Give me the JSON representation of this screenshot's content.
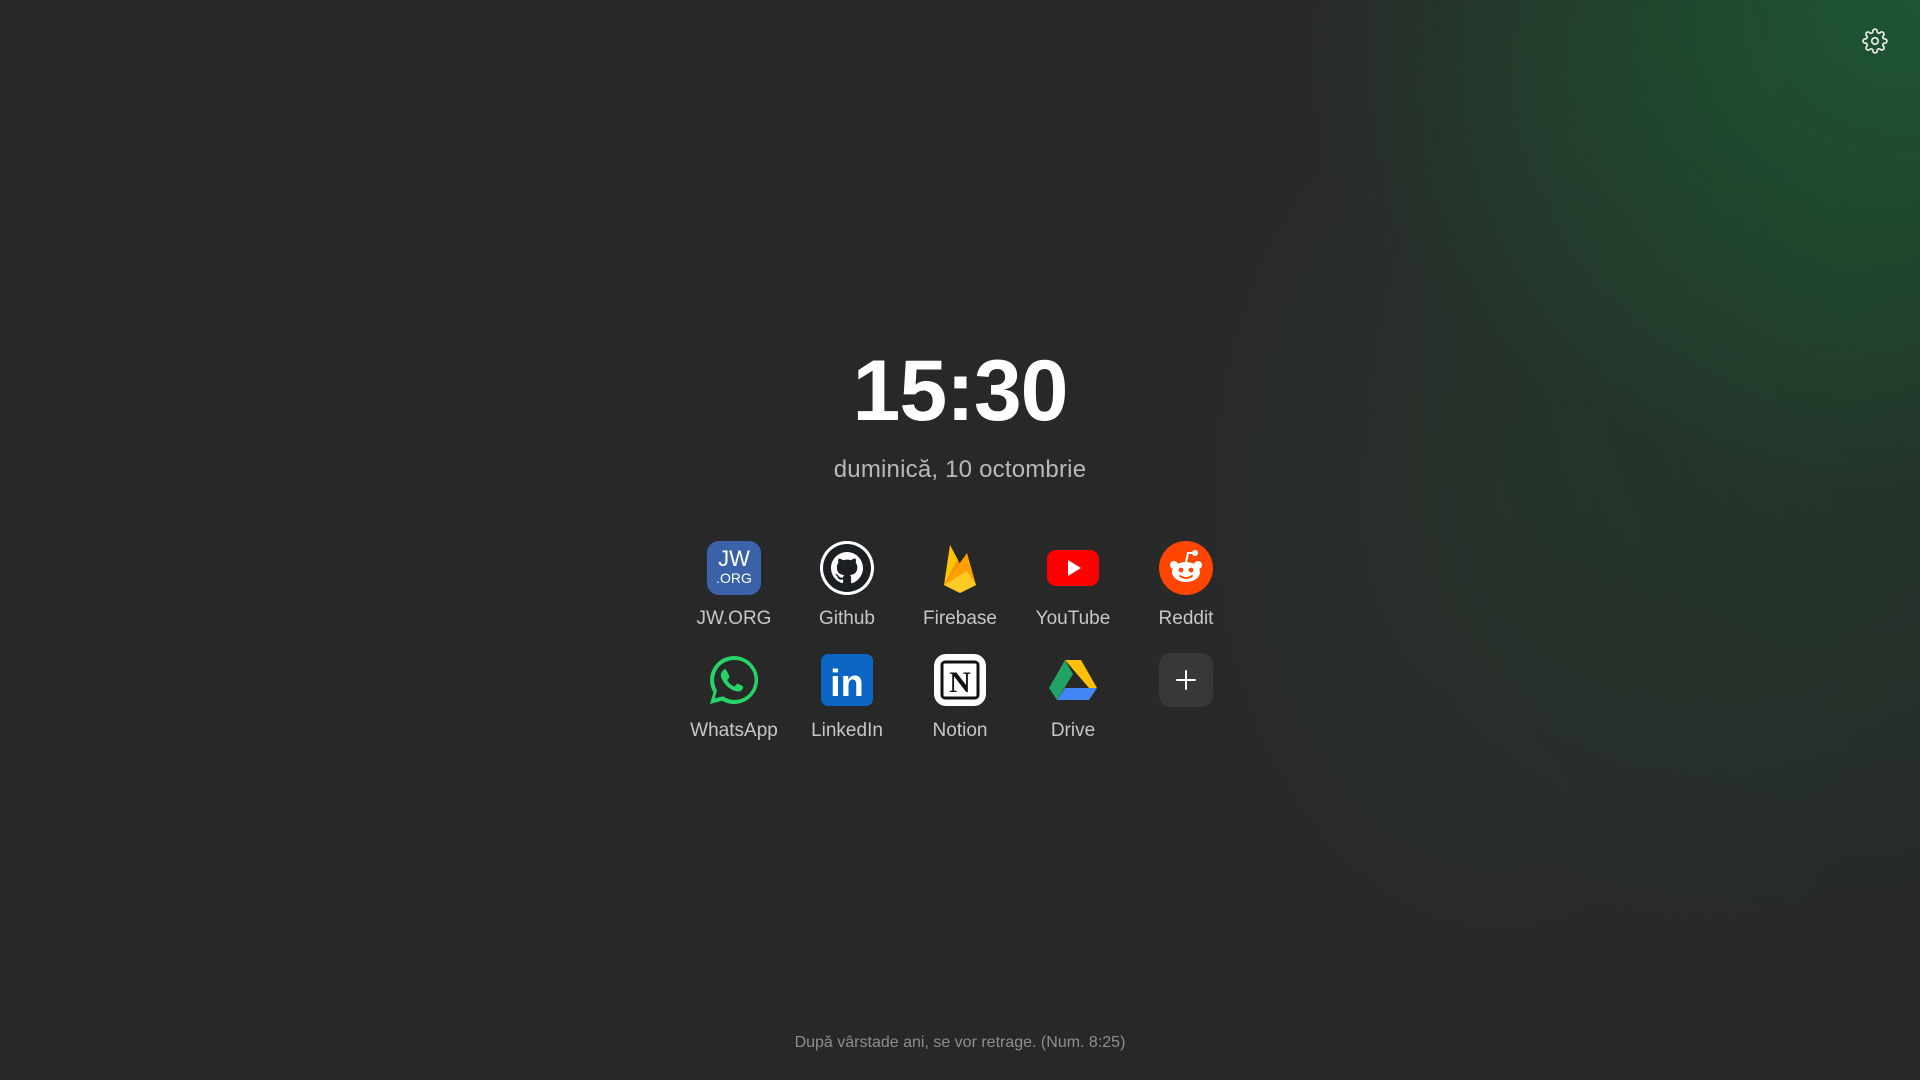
{
  "clock": {
    "time": "15:30",
    "date": "duminică, 10 octombrie"
  },
  "settings": {
    "icon": "gear-icon"
  },
  "shortcuts": [
    {
      "label": "JW.ORG",
      "icon": "jworg-icon",
      "icon_text_top": "JW",
      "icon_text_bottom": ".ORG",
      "color": "#3a62a8"
    },
    {
      "label": "Github",
      "icon": "github-icon",
      "color": "#ffffff"
    },
    {
      "label": "Firebase",
      "icon": "firebase-icon",
      "color": "#ffa611"
    },
    {
      "label": "YouTube",
      "icon": "youtube-icon",
      "color": "#ff0000"
    },
    {
      "label": "Reddit",
      "icon": "reddit-icon",
      "color": "#ff4500"
    },
    {
      "label": "WhatsApp",
      "icon": "whatsapp-icon",
      "color": "#25d366"
    },
    {
      "label": "LinkedIn",
      "icon": "linkedin-icon",
      "icon_text": "in",
      "color": "#0a66c2"
    },
    {
      "label": "Notion",
      "icon": "notion-icon",
      "icon_text": "N",
      "color": "#ffffff"
    },
    {
      "label": "Drive",
      "icon": "google-drive-icon",
      "color": "#1fa463"
    }
  ],
  "add_shortcut": {
    "icon": "plus-icon"
  },
  "footer": {
    "quote": "După vârstade ani, se vor retrage. (Num. 8:25)"
  },
  "colors": {
    "background": "#282828",
    "accent_glow": "#1c5c34"
  }
}
